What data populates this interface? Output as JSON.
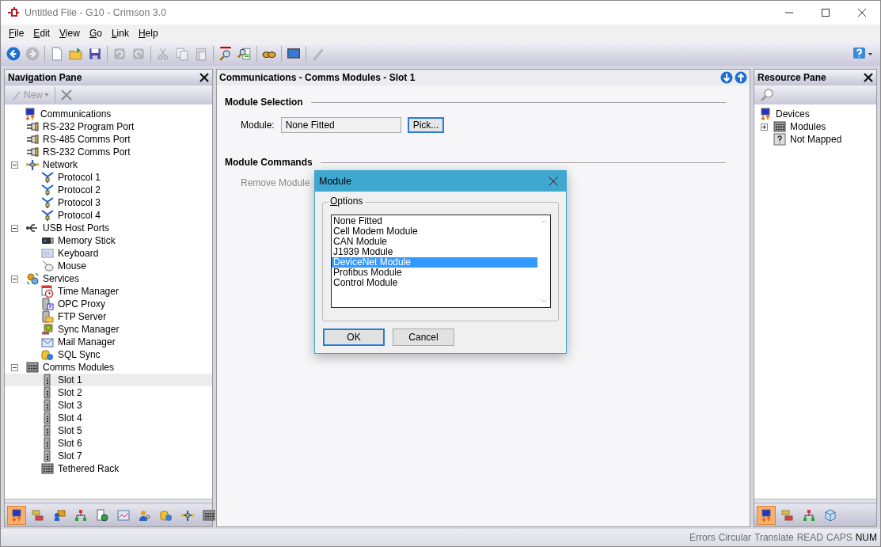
{
  "window": {
    "title": "Untitled File - G10 - Crimson 3.0"
  },
  "menu": [
    "File",
    "Edit",
    "View",
    "Go",
    "Link",
    "Help"
  ],
  "toolbar": [
    {
      "kind": "back",
      "disabled": false
    },
    {
      "kind": "forward",
      "disabled": true
    },
    {
      "kind": "separator"
    },
    {
      "kind": "new",
      "disabled": false
    },
    {
      "kind": "open",
      "disabled": false
    },
    {
      "kind": "save",
      "disabled": false
    },
    {
      "kind": "separator"
    },
    {
      "kind": "undo",
      "disabled": true
    },
    {
      "kind": "redo",
      "disabled": true
    },
    {
      "kind": "separator"
    },
    {
      "kind": "cut",
      "disabled": true
    },
    {
      "kind": "copy",
      "disabled": true
    },
    {
      "kind": "paste",
      "disabled": true
    },
    {
      "kind": "separator"
    },
    {
      "kind": "find-all",
      "disabled": false
    },
    {
      "kind": "find",
      "disabled": false
    },
    {
      "kind": "separator"
    },
    {
      "kind": "binoculars",
      "disabled": false
    },
    {
      "kind": "separator"
    },
    {
      "kind": "monitor",
      "disabled": false
    },
    {
      "kind": "separator"
    },
    {
      "kind": "pen",
      "disabled": true
    }
  ],
  "nav_pane": {
    "title": "Navigation Pane",
    "new_button": {
      "label": "New",
      "disabled": true
    },
    "delete_disabled": true,
    "tree": [
      {
        "label": "Communications",
        "kind": "comms",
        "selected": false,
        "children": [
          {
            "label": "RS-232 Program Port",
            "kind": "port",
            "selected": false
          },
          {
            "label": "RS-485 Comms Port",
            "kind": "port",
            "selected": false
          },
          {
            "label": "RS-232 Comms Port",
            "kind": "port",
            "selected": false
          },
          {
            "label": "Network",
            "kind": "network",
            "selected": false,
            "expanded": true,
            "children": [
              {
                "label": "Protocol 1",
                "kind": "protocol",
                "selected": false
              },
              {
                "label": "Protocol 2",
                "kind": "protocol",
                "selected": false
              },
              {
                "label": "Protocol 3",
                "kind": "protocol",
                "selected": false
              },
              {
                "label": "Protocol 4",
                "kind": "protocol",
                "selected": false
              }
            ]
          },
          {
            "label": "USB Host Ports",
            "kind": "usb",
            "selected": false,
            "expanded": true,
            "children": [
              {
                "label": "Memory Stick",
                "kind": "stick",
                "selected": false
              },
              {
                "label": "Keyboard",
                "kind": "keyboard",
                "selected": false
              },
              {
                "label": "Mouse",
                "kind": "mouse",
                "selected": false
              }
            ]
          },
          {
            "label": "Services",
            "kind": "gears",
            "selected": false,
            "expanded": true,
            "children": [
              {
                "label": "Time Manager",
                "kind": "clock",
                "selected": false
              },
              {
                "label": "OPC Proxy",
                "kind": "server",
                "selected": false
              },
              {
                "label": "FTP Server",
                "kind": "folder-server",
                "selected": false
              },
              {
                "label": "Sync Manager",
                "kind": "sync",
                "selected": false
              },
              {
                "label": "Mail Manager",
                "kind": "mail",
                "selected": false
              },
              {
                "label": "SQL Sync",
                "kind": "database",
                "selected": false
              }
            ]
          },
          {
            "label": "Comms Modules",
            "kind": "rack",
            "selected": false,
            "expanded": true,
            "children": [
              {
                "label": "Slot 1",
                "kind": "slot",
                "selected": true
              },
              {
                "label": "Slot 2",
                "kind": "slot",
                "selected": false
              },
              {
                "label": "Slot 3",
                "kind": "slot",
                "selected": false
              },
              {
                "label": "Slot 4",
                "kind": "slot",
                "selected": false
              },
              {
                "label": "Slot 5",
                "kind": "slot",
                "selected": false
              },
              {
                "label": "Slot 6",
                "kind": "slot",
                "selected": false
              },
              {
                "label": "Slot 7",
                "kind": "slot",
                "selected": false
              },
              {
                "label": "Tethered Rack",
                "kind": "rack",
                "selected": false
              }
            ]
          }
        ]
      }
    ],
    "tabs": [
      {
        "kind": "comms",
        "selected": true
      },
      {
        "kind": "tags",
        "selected": false
      },
      {
        "kind": "display",
        "selected": false
      },
      {
        "kind": "programs",
        "selected": false
      },
      {
        "kind": "web",
        "selected": false
      },
      {
        "kind": "chart",
        "selected": false
      },
      {
        "kind": "security",
        "selected": false
      },
      {
        "kind": "database",
        "selected": false
      },
      {
        "kind": "network",
        "selected": false
      },
      {
        "kind": "rack",
        "selected": false
      }
    ]
  },
  "editor": {
    "title": "Communications - Comms Modules - Slot 1",
    "module_selection": {
      "heading": "Module Selection",
      "label": "Module:",
      "value": "None Fitted",
      "button": "Pick..."
    },
    "module_commands": {
      "heading": "Module Commands",
      "button": {
        "label": "Remove Module",
        "disabled": true
      }
    }
  },
  "resource_pane": {
    "title": "Resource Pane",
    "tree": [
      {
        "label": "Devices",
        "kind": "comms",
        "selected": false,
        "children": [
          {
            "label": "Modules",
            "kind": "rack",
            "selected": false,
            "expanded": false
          },
          {
            "label": "Not Mapped",
            "kind": "question",
            "selected": false
          }
        ]
      }
    ],
    "tabs": [
      {
        "kind": "comms",
        "selected": true
      },
      {
        "kind": "tags",
        "selected": false
      },
      {
        "kind": "programs",
        "selected": false
      },
      {
        "kind": "cube",
        "selected": false
      }
    ]
  },
  "dialog": {
    "title": "Module",
    "group": "Options",
    "items": [
      {
        "label": "None Fitted",
        "selected": false
      },
      {
        "label": "Cell Modem Module",
        "selected": false
      },
      {
        "label": "CAN Module",
        "selected": false
      },
      {
        "label": "J1939 Module",
        "selected": false
      },
      {
        "label": "DeviceNet Module",
        "selected": true
      },
      {
        "label": "Profibus Module",
        "selected": false
      },
      {
        "label": "Control Module",
        "selected": false
      }
    ],
    "buttons": [
      {
        "label": "OK",
        "default": true
      },
      {
        "label": "Cancel",
        "default": false
      }
    ]
  },
  "status_bar": [
    {
      "label": "Errors",
      "on": false
    },
    {
      "label": "Circular",
      "on": false
    },
    {
      "label": "Translate",
      "on": false
    },
    {
      "label": "READ",
      "on": false
    },
    {
      "label": "CAPS",
      "on": false
    },
    {
      "label": "NUM",
      "on": true
    }
  ]
}
